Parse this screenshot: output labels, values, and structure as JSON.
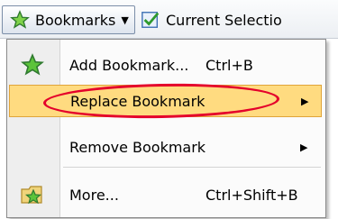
{
  "toolbar": {
    "bookmarks_label": "Bookmarks",
    "bookmarks_icon": "star-icon",
    "selection_label": "Current Selectio",
    "selection_icon": "checkbox-icon"
  },
  "menu": {
    "items": [
      {
        "label": "Add Bookmark...",
        "shortcut": "Ctrl+B",
        "icon": "star-icon",
        "has_submenu": false
      },
      {
        "label": "Replace Bookmark",
        "shortcut": "",
        "icon": "",
        "has_submenu": true,
        "highlighted": true
      },
      {
        "label": "Remove Bookmark",
        "shortcut": "",
        "icon": "",
        "has_submenu": true
      },
      {
        "label": "More...",
        "shortcut": "Ctrl+Shift+B",
        "icon": "folder-star-icon",
        "has_submenu": false
      }
    ]
  },
  "colors": {
    "highlight_fill": "#ffdb80",
    "highlight_border": "#e0a43a",
    "annotation_red": "#e4002b",
    "star_green": "#2f9a2f"
  }
}
